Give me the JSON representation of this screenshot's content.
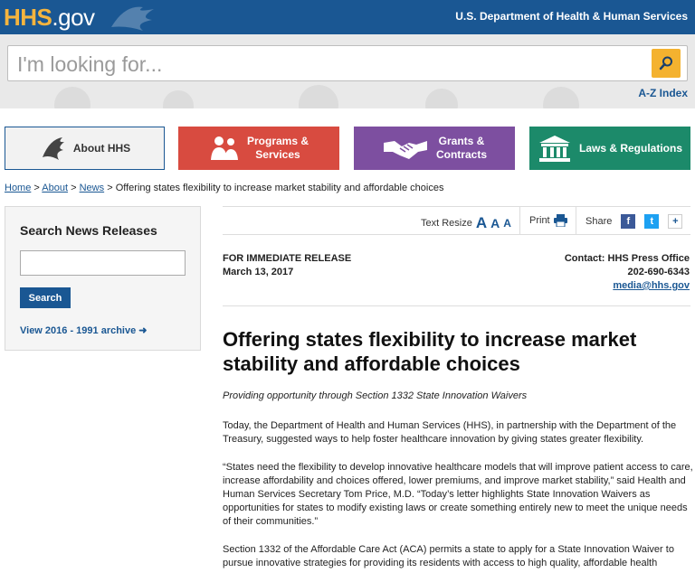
{
  "header": {
    "logo_hhs": "HHS",
    "logo_gov": ".gov",
    "department": "U.S. Department of Health & Human Services"
  },
  "search": {
    "placeholder": "I'm looking for...",
    "az_index": "A-Z Index"
  },
  "nav": {
    "about": "About HHS",
    "programs_line1": "Programs &",
    "programs_line2": "Services",
    "grants_line1": "Grants &",
    "grants_line2": "Contracts",
    "laws": "Laws & Regulations"
  },
  "breadcrumb": {
    "home": "Home",
    "about": "About",
    "news": "News",
    "sep": ">",
    "current": "Offering states flexibility to increase market stability and affordable choices"
  },
  "sidebar": {
    "title": "Search News Releases",
    "button": "Search",
    "archive": "View 2016 - 1991 archive"
  },
  "toolbar": {
    "text_resize": "Text Resize",
    "a_large": "A",
    "a_medium": "A",
    "a_small": "A",
    "print": "Print",
    "share": "Share",
    "more": "+"
  },
  "release": {
    "label": "FOR IMMEDIATE RELEASE",
    "date": "March 13, 2017",
    "contact": "Contact: HHS Press Office",
    "phone": "202-690-6343",
    "email": "media@hhs.gov"
  },
  "article": {
    "headline": "Offering states flexibility to increase market stability and affordable choices",
    "subhead": "Providing opportunity through Section 1332 State Innovation Waivers",
    "p1": "Today, the Department of Health and Human Services (HHS), in partnership with the Department of the Treasury, suggested ways to help foster healthcare innovation by giving states greater flexibility.",
    "p2": "“States need the flexibility to develop innovative healthcare models that will improve patient access to care, increase affordability and choices offered, lower premiums, and improve market stability,” said Health and Human Services Secretary Tom Price, M.D. “Today’s letter highlights State Innovation Waivers as opportunities for states to modify existing laws or create something entirely new to meet the unique needs of their communities.”",
    "p3": "Section 1332 of the Affordable Care Act (ACA) permits a state to apply for a State Innovation Waiver to pursue innovative strategies for providing its residents with access to high quality, affordable health"
  },
  "colors": {
    "brand_blue": "#1a5793",
    "accent_gold": "#f4b22f",
    "programs_red": "#d84b40",
    "grants_purple": "#7d4fa0",
    "laws_green": "#1c8a6a"
  },
  "icons": [
    "search-icon",
    "eagle-icon",
    "people-icon",
    "handshake-icon",
    "building-icon",
    "print-icon",
    "facebook-icon",
    "twitter-icon",
    "arrow-right-icon"
  ]
}
